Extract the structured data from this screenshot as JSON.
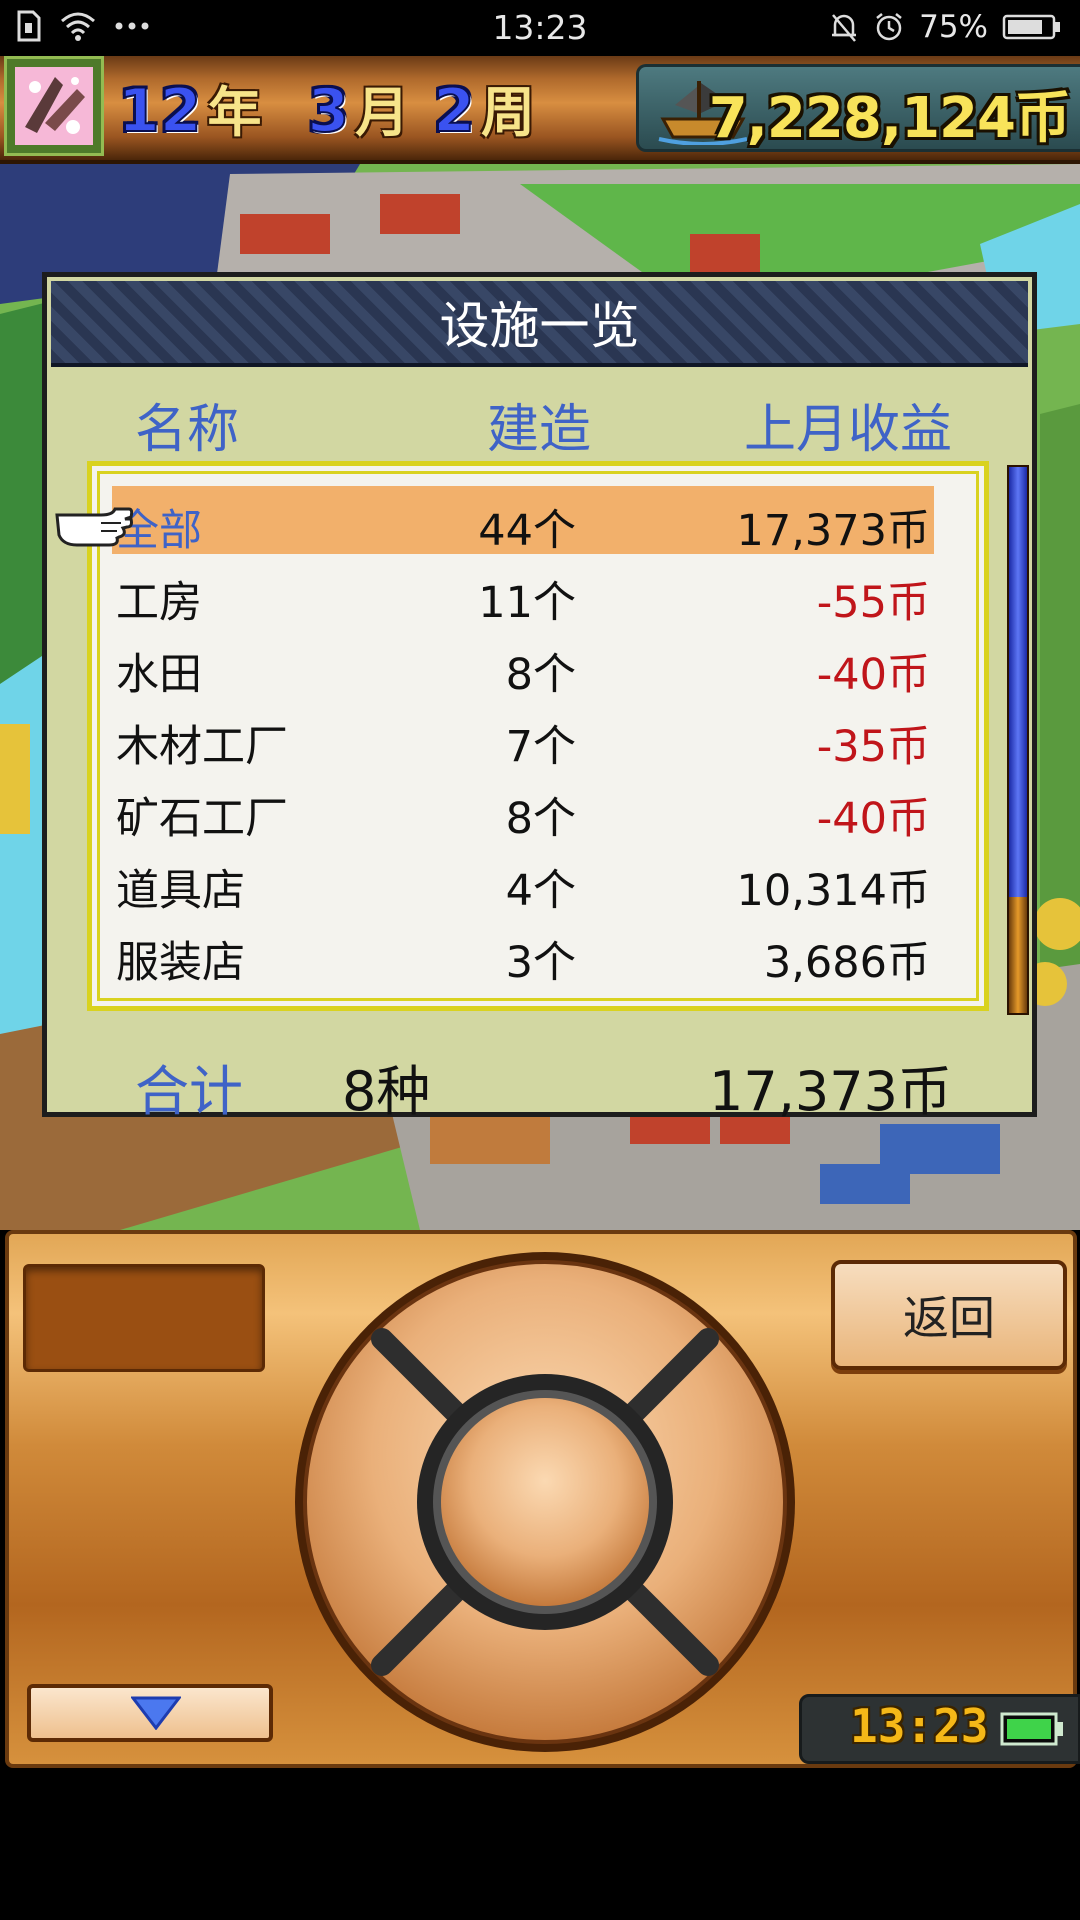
{
  "status_bar": {
    "time": "13:23",
    "battery_percent": "75%",
    "icons": [
      "sim-icon",
      "wifi-icon",
      "more-dots-icon",
      "mute-bell-icon",
      "alarm-icon",
      "battery-icon"
    ]
  },
  "header": {
    "year": "12",
    "year_unit": "年",
    "month": "3",
    "month_unit": "月",
    "week": "2",
    "week_unit": "周",
    "money": "7,228,124币"
  },
  "dialog": {
    "title": "设施一览",
    "columns": {
      "name": "名称",
      "built": "建造",
      "income": "上月收益"
    },
    "rows": [
      {
        "name": "全部",
        "count": "44个",
        "income": "17,373币",
        "negative": false,
        "selected": true
      },
      {
        "name": "工房",
        "count": "11个",
        "income": "-55币",
        "negative": true,
        "selected": false
      },
      {
        "name": "水田",
        "count": "8个",
        "income": "-40币",
        "negative": true,
        "selected": false
      },
      {
        "name": "木材工厂",
        "count": "7个",
        "income": "-35币",
        "negative": true,
        "selected": false
      },
      {
        "name": "矿石工厂",
        "count": "8个",
        "income": "-40币",
        "negative": true,
        "selected": false
      },
      {
        "name": "道具店",
        "count": "4个",
        "income": "10,314币",
        "negative": false,
        "selected": false
      },
      {
        "name": "服装店",
        "count": "3个",
        "income": "3,686币",
        "negative": false,
        "selected": false
      }
    ],
    "total": {
      "label": "合计",
      "kinds": "8种",
      "income": "17,373币"
    }
  },
  "controls": {
    "back_label": "返回",
    "clock": "13:23"
  },
  "colors": {
    "accent_blue": "#3f63c7",
    "negative_red": "#c0151a",
    "selected_row": "#f2b06b",
    "money_yellow": "#f8e35a"
  }
}
